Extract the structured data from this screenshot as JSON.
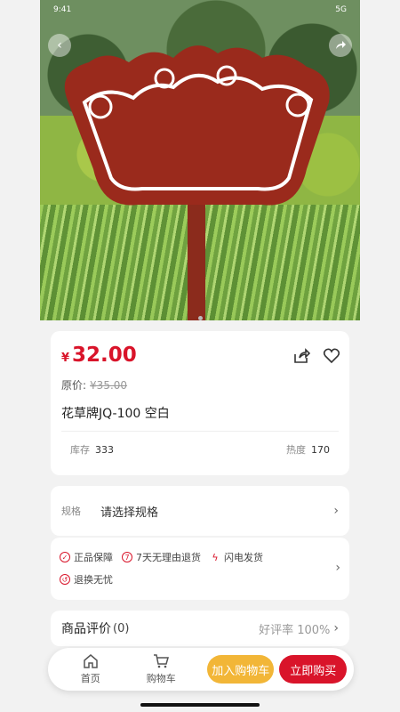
{
  "hero": {
    "image": "flower-bed sign on pole in grass",
    "carousel_dots": 1
  },
  "status": {
    "left": "9:41",
    "right": "5G"
  },
  "product": {
    "currency": "¥",
    "price": "32.00",
    "original_label": "原价:",
    "original_price": "¥35.00",
    "title": "花草牌JQ-100 空白",
    "stock_label": "库存",
    "stock_value": "333",
    "hot_label": "热度",
    "hot_value": "170"
  },
  "spec": {
    "label": "规格",
    "value": "请选择规格"
  },
  "services": [
    {
      "icon": "shield-icon",
      "label": "正品保障"
    },
    {
      "icon": "seven-day-icon",
      "label": "7天无理由退货"
    },
    {
      "icon": "lightning-icon",
      "label": "闪电发货"
    },
    {
      "icon": "exchange-icon",
      "label": "退换无忧"
    }
  ],
  "reviews": {
    "title": "商品评价",
    "count": "(0)",
    "rate": "好评率 100%"
  },
  "bottom_bar": {
    "home_label": "首页",
    "cart_label": "购物车",
    "add_to_cart": "加入购物车",
    "buy_now": "立即购买"
  },
  "colors": {
    "accent": "#d9142a",
    "cart_button": "#f2b637",
    "sign": "#9a2a1c"
  }
}
